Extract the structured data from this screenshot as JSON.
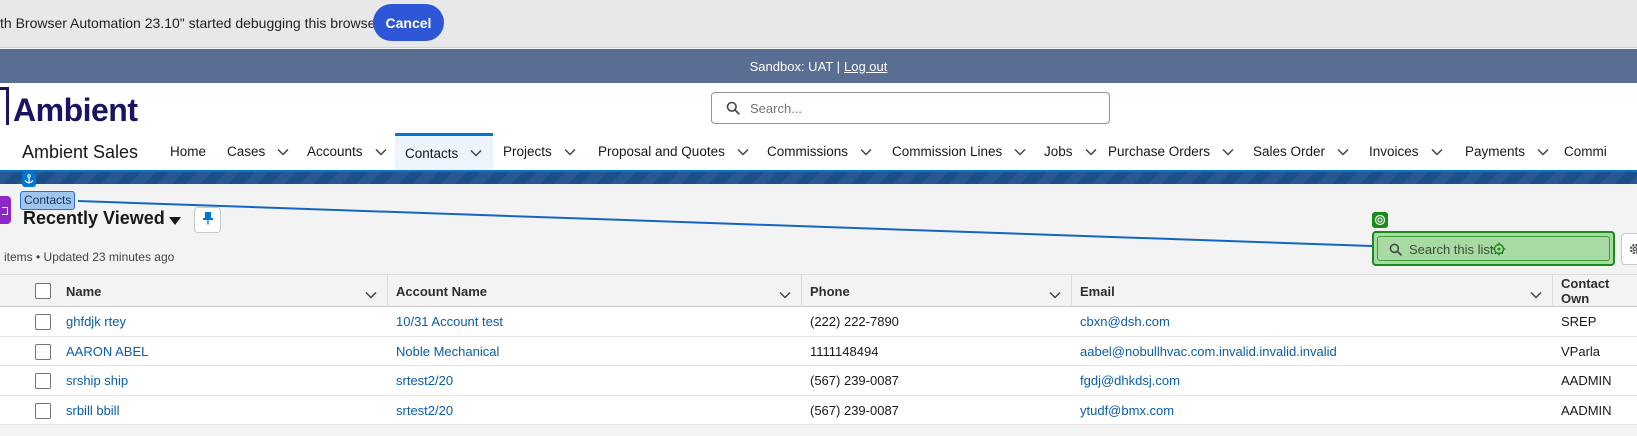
{
  "debug_bar": {
    "message": "th Browser Automation 23.10\" started debugging this browser",
    "cancel_label": "Cancel"
  },
  "sandbox_bar": {
    "text": "Sandbox: UAT |",
    "logout_label": "Log out"
  },
  "header": {
    "logo_text": "Ambient",
    "search_placeholder": "Search..."
  },
  "app": {
    "name": "Ambient Sales"
  },
  "nav": {
    "items": [
      {
        "label": "Home"
      },
      {
        "label": "Cases"
      },
      {
        "label": "Accounts"
      },
      {
        "label": "Contacts"
      },
      {
        "label": "Projects"
      },
      {
        "label": "Proposal and Quotes"
      },
      {
        "label": "Commissions"
      },
      {
        "label": "Commission Lines"
      },
      {
        "label": "Jobs"
      },
      {
        "label": "Purchase Orders"
      },
      {
        "label": "Sales Order"
      },
      {
        "label": "Invoices"
      },
      {
        "label": "Payments"
      },
      {
        "label": "Commi"
      }
    ]
  },
  "list_view": {
    "tag_label": "Contacts",
    "title": "Recently Viewed",
    "updated_text": "items • Updated 23 minutes ago",
    "search_placeholder": "Search this list..."
  },
  "table": {
    "columns": [
      {
        "label": "Name"
      },
      {
        "label": "Account Name"
      },
      {
        "label": "Phone"
      },
      {
        "label": "Email"
      },
      {
        "label": "Contact Own"
      }
    ],
    "rows": [
      {
        "name": "ghfdjk rtey",
        "account": "10/31 Account test",
        "phone": "(222) 222-7890",
        "email": "cbxn@dsh.com",
        "owner": "SREP"
      },
      {
        "name": "AARON ABEL",
        "account": "Noble Mechanical",
        "phone": "1111148494",
        "email": "aabel@nobullhvac.com.invalid.invalid.invalid",
        "owner": "VParla"
      },
      {
        "name": "srship ship",
        "account": "srtest2/20",
        "phone": "(567) 239-0087",
        "email": "fgdj@dhkdsj.com",
        "owner": "AADMIN"
      },
      {
        "name": "srbill bbill",
        "account": "srtest2/20",
        "phone": "(567) 239-0087",
        "email": "ytudf@bmx.com",
        "owner": "AADMIN"
      }
    ]
  },
  "colors": {
    "cancel_button": "#2f56d6",
    "sandbox_bar": "#5a6e93",
    "brand": "#1b1464",
    "active_tab": "#0176d3",
    "link": "#0b5cab",
    "highlight_green": "#a8dba4"
  }
}
